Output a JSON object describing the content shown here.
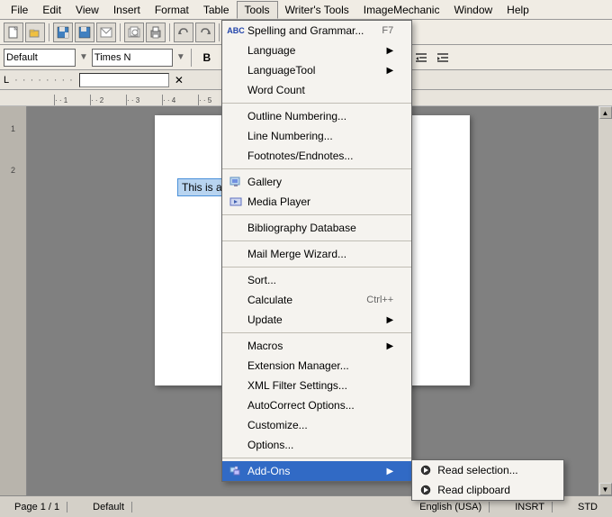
{
  "menubar": {
    "items": [
      "File",
      "Edit",
      "View",
      "Insert",
      "Format",
      "Table",
      "Tools",
      "Writer's Tools",
      "ImageMechanic",
      "Window",
      "Help"
    ]
  },
  "toolbar1": {
    "style_value": "Default",
    "font_value": "Times N"
  },
  "ruler": {
    "marks": [
      "1",
      "2",
      "3",
      "4"
    ]
  },
  "tools_menu": {
    "items": [
      {
        "label": "Spelling and Grammar...",
        "shortcut": "F7",
        "submenu": false,
        "icon": "ABC",
        "separator_after": false
      },
      {
        "label": "Language",
        "shortcut": "",
        "submenu": true,
        "icon": "",
        "separator_after": false
      },
      {
        "label": "LanguageTool",
        "shortcut": "",
        "submenu": true,
        "icon": "",
        "separator_after": false
      },
      {
        "label": "Word Count",
        "shortcut": "",
        "submenu": false,
        "icon": "",
        "separator_after": true
      },
      {
        "label": "Outline Numbering...",
        "shortcut": "",
        "submenu": false,
        "icon": "",
        "separator_after": false
      },
      {
        "label": "Line Numbering...",
        "shortcut": "",
        "submenu": false,
        "icon": "",
        "separator_after": false
      },
      {
        "label": "Footnotes/Endnotes...",
        "shortcut": "",
        "submenu": false,
        "icon": "",
        "separator_after": true
      },
      {
        "label": "Gallery",
        "shortcut": "",
        "submenu": false,
        "icon": "gallery",
        "separator_after": false
      },
      {
        "label": "Media Player",
        "shortcut": "",
        "submenu": false,
        "icon": "media",
        "separator_after": true
      },
      {
        "label": "Bibliography Database",
        "shortcut": "",
        "submenu": false,
        "icon": "",
        "separator_after": true
      },
      {
        "label": "Mail Merge Wizard...",
        "shortcut": "",
        "submenu": false,
        "icon": "",
        "separator_after": true
      },
      {
        "label": "Sort...",
        "shortcut": "",
        "submenu": false,
        "icon": "",
        "separator_after": false
      },
      {
        "label": "Calculate",
        "shortcut": "Ctrl++",
        "submenu": false,
        "icon": "",
        "separator_after": false
      },
      {
        "label": "Update",
        "shortcut": "",
        "submenu": true,
        "icon": "",
        "separator_after": true
      },
      {
        "label": "Macros",
        "shortcut": "",
        "submenu": true,
        "icon": "",
        "separator_after": false
      },
      {
        "label": "Extension Manager...",
        "shortcut": "",
        "submenu": false,
        "icon": "",
        "separator_after": false
      },
      {
        "label": "XML Filter Settings...",
        "shortcut": "",
        "submenu": false,
        "icon": "",
        "separator_after": false
      },
      {
        "label": "AutoCorrect Options...",
        "shortcut": "",
        "submenu": false,
        "icon": "",
        "separator_after": false
      },
      {
        "label": "Customize...",
        "shortcut": "",
        "submenu": false,
        "icon": "",
        "separator_after": false
      },
      {
        "label": "Options...",
        "shortcut": "",
        "submenu": false,
        "icon": "",
        "separator_after": true
      },
      {
        "label": "Add-Ons",
        "shortcut": "",
        "submenu": true,
        "icon": "addon",
        "separator_after": false,
        "active": true
      }
    ]
  },
  "addons_submenu": {
    "items": [
      {
        "label": "Read selection...",
        "icon": "read"
      },
      {
        "label": "Read clipboard",
        "icon": "read"
      }
    ]
  },
  "document": {
    "highlighted_text": "This is a very cool extension."
  },
  "statusbar": {
    "page": "Page 1 / 1",
    "style": "Default",
    "language": "English (USA)",
    "mode": "INSRT",
    "std": "STD"
  }
}
